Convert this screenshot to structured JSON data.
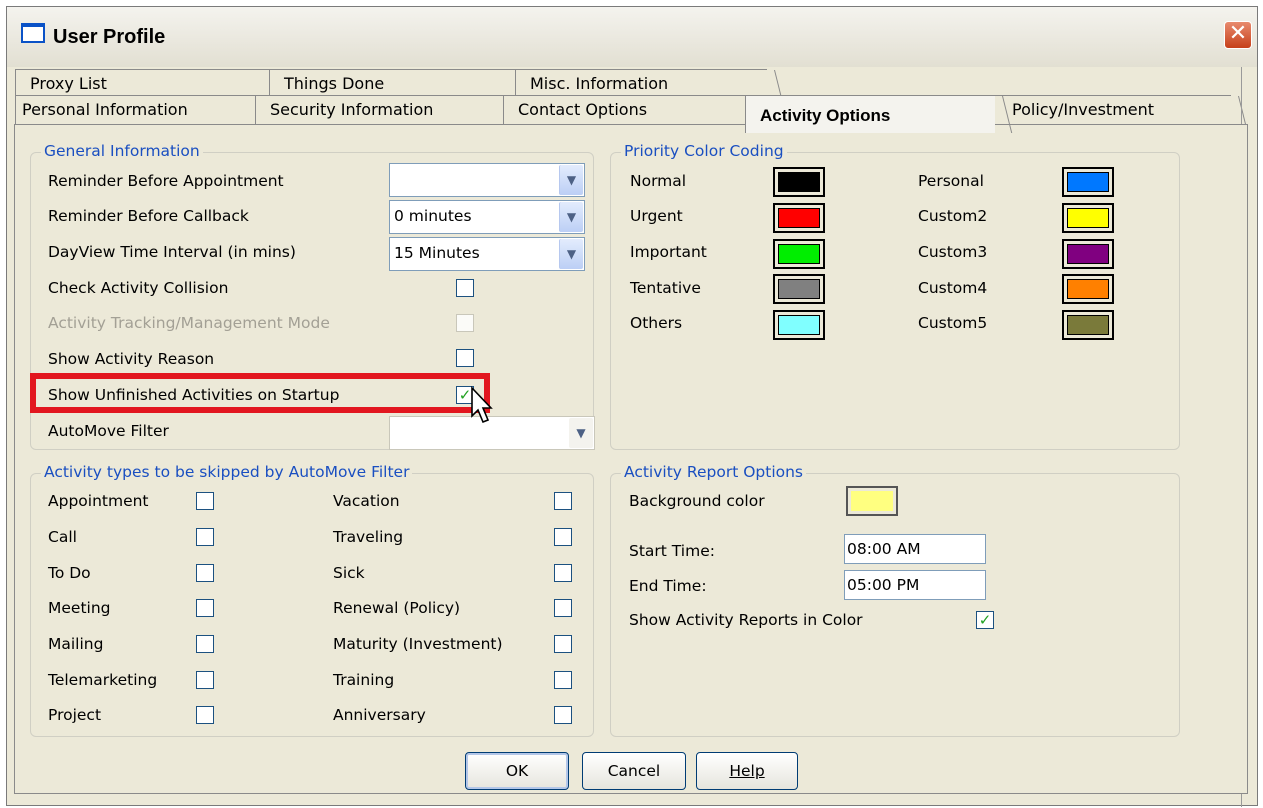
{
  "window": {
    "title": "User Profile",
    "close_glyph": "✕"
  },
  "tabs": {
    "row1": [
      "Proxy List",
      "Things Done",
      "Misc. Information"
    ],
    "row2": [
      "Personal Information",
      "Security Information",
      "Contact Options",
      "Activity Options",
      "Policy/Investment"
    ],
    "active": "Activity Options"
  },
  "general": {
    "title": "General Information",
    "reminder_appt": {
      "label": "Reminder Before Appointment",
      "value": ""
    },
    "reminder_callback": {
      "label": "Reminder Before Callback",
      "value": "0 minutes"
    },
    "dayview": {
      "label": "DayView Time Interval (in mins)",
      "value": "15 Minutes"
    },
    "check_collision": {
      "label": "Check Activity Collision",
      "checked": false
    },
    "tracking_mode": {
      "label": "Activity Tracking/Management Mode",
      "checked": false,
      "disabled": true
    },
    "show_reason": {
      "label": "Show Activity Reason",
      "checked": false
    },
    "show_unfinished": {
      "label": "Show Unfinished Activities on Startup",
      "checked": true
    },
    "automove": {
      "label": "AutoMove Filter",
      "value": ""
    }
  },
  "priority": {
    "title": "Priority Color Coding",
    "left": [
      {
        "label": "Normal",
        "color": "#000000"
      },
      {
        "label": "Urgent",
        "color": "#ff0000"
      },
      {
        "label": "Important",
        "color": "#00ee00"
      },
      {
        "label": "Tentative",
        "color": "#808080"
      },
      {
        "label": "Others",
        "color": "#80ffff"
      }
    ],
    "right": [
      {
        "label": "Personal",
        "color": "#0078ff"
      },
      {
        "label": "Custom2",
        "color": "#ffff00"
      },
      {
        "label": "Custom3",
        "color": "#800080"
      },
      {
        "label": "Custom4",
        "color": "#ff8000"
      },
      {
        "label": "Custom5",
        "color": "#7a7a3a"
      }
    ]
  },
  "skipped": {
    "title": "Activity types to be skipped by AutoMove Filter",
    "left": [
      "Appointment",
      "Call",
      "To Do",
      "Meeting",
      "Mailing",
      "Telemarketing",
      "Project"
    ],
    "right": [
      "Vacation",
      "Traveling",
      "Sick",
      "Renewal (Policy)",
      "Maturity (Investment)",
      "Training",
      "Anniversary"
    ]
  },
  "report": {
    "title": "Activity Report Options",
    "bg_label": "Background color",
    "bg_color": "#ffff80",
    "start_label": "Start Time:",
    "start_value": "08:00 AM",
    "end_label": "End Time:",
    "end_value": "05:00 PM",
    "show_color_label": "Show Activity Reports in Color",
    "show_color_checked": true
  },
  "buttons": {
    "ok": "OK",
    "cancel": "Cancel",
    "help": "Help"
  },
  "icons": {
    "check": "✓",
    "dropdown": "chevron-down-icon"
  }
}
